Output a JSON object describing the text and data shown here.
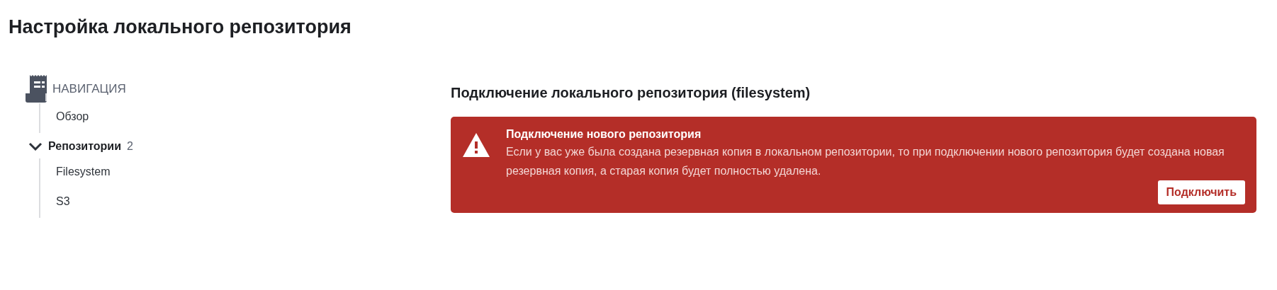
{
  "page_title": "Настройка локального репозитория",
  "sidebar": {
    "header": "НАВИГАЦИЯ",
    "items": [
      {
        "label": "Обзор"
      },
      {
        "label": "Репозитории",
        "count": "2",
        "expanded": true,
        "children": [
          {
            "label": "Filesystem"
          },
          {
            "label": "S3"
          }
        ]
      }
    ]
  },
  "main": {
    "heading": "Подключение локального репозитория (filesystem)",
    "alert": {
      "title": "Подключение нового репозитория",
      "text": "Если у вас уже была создана резервная копия в локальном репозитории, то при подключении нового репозитория будет создана новая резервная копия, а старая копия будет полностью удалена.",
      "button": "Подключить"
    }
  }
}
